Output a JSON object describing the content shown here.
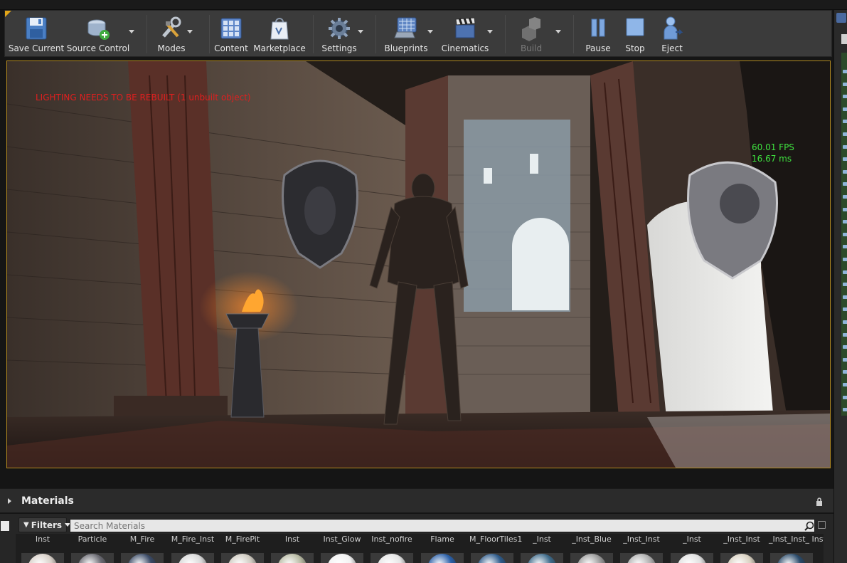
{
  "toolbar": {
    "save_current": "Save Current",
    "source_control": "Source Control",
    "modes": "Modes",
    "content": "Content",
    "marketplace": "Marketplace",
    "settings": "Settings",
    "blueprints": "Blueprints",
    "cinematics": "Cinematics",
    "build": "Build",
    "pause": "Pause",
    "stop": "Stop",
    "eject": "Eject"
  },
  "viewport": {
    "warning": "LIGHTING NEEDS TO BE REBUILT (1 unbuilt object)",
    "fps": "60.01 FPS",
    "ms": "16.67 ms"
  },
  "content_browser": {
    "title": "Materials",
    "filters_label": "Filters",
    "search_placeholder": "Search Materials",
    "assets": [
      {
        "label": "Inst",
        "color": "#d8d0c8"
      },
      {
        "label": "Particle",
        "color": "#6a6a72"
      },
      {
        "label": "M_Fire",
        "color": "#3a4a66"
      },
      {
        "label": "M_Fire_Inst",
        "color": "#d8d8d8"
      },
      {
        "label": "M_FirePit",
        "color": "#cfcac0"
      },
      {
        "label": "Inst",
        "color": "#b7b9a2"
      },
      {
        "label": "Inst_Glow",
        "color": "#f2f2f2"
      },
      {
        "label": "Inst_nofire",
        "color": "#e5e5e5"
      },
      {
        "label": "Flame",
        "color": "#2a5fa8"
      },
      {
        "label": "M_FloorTiles1",
        "color": "#2d5a8a"
      },
      {
        "label": "_Inst",
        "color": "#3d6a8a"
      },
      {
        "label": "_Inst_Blue",
        "color": "#9a9a9a"
      },
      {
        "label": "_Inst_Inst",
        "color": "#b0b0b0"
      },
      {
        "label": "_Inst",
        "color": "#e0e0e0"
      },
      {
        "label": "_Inst_Inst",
        "color": "#d8d0c0"
      },
      {
        "label": "_Inst_Inst_ Inst",
        "color": "#2a4a6a"
      }
    ]
  }
}
